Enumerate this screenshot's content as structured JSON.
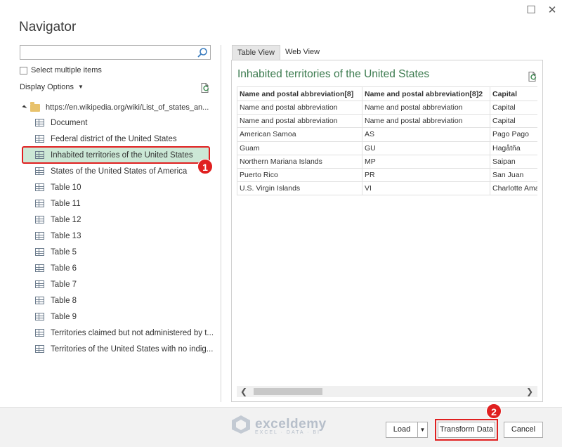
{
  "window": {
    "title": "Navigator",
    "maximize_glyph": "☐",
    "close_glyph": "✕"
  },
  "left": {
    "search_placeholder": "",
    "select_multiple_label": "Select multiple items",
    "display_options_label": "Display Options",
    "root_label": "https://en.wikipedia.org/wiki/List_of_states_an...",
    "items": [
      {
        "label": "Document"
      },
      {
        "label": "Federal district of the United States"
      },
      {
        "label": "Inhabited territories of the United States",
        "selected": true
      },
      {
        "label": "States of the United States of America"
      },
      {
        "label": "Table 10"
      },
      {
        "label": "Table 11"
      },
      {
        "label": "Table 12"
      },
      {
        "label": "Table 13"
      },
      {
        "label": "Table 5"
      },
      {
        "label": "Table 6"
      },
      {
        "label": "Table 7"
      },
      {
        "label": "Table 8"
      },
      {
        "label": "Table 9"
      },
      {
        "label": "Territories claimed but not administered by t..."
      },
      {
        "label": "Territories of the United States with no indig..."
      }
    ]
  },
  "annotations": {
    "badge1": "1",
    "badge2": "2",
    "badge_color": "#e02020"
  },
  "right": {
    "tabs": [
      {
        "label": "Table View",
        "active": true
      },
      {
        "label": "Web View",
        "active": false
      }
    ],
    "preview_title": "Inhabited territories of the United States",
    "columns": [
      "Name and postal abbreviation[8]",
      "Name and postal abbreviation[8]2",
      "Capital"
    ],
    "rows": [
      [
        "Name and postal abbreviation",
        "Name and postal abbreviation",
        "Capital"
      ],
      [
        "Name and postal abbreviation",
        "Name and postal abbreviation",
        "Capital"
      ],
      [
        "American Samoa",
        "AS",
        "Pago Pago"
      ],
      [
        "Guam",
        "GU",
        "Hagåtña"
      ],
      [
        "Northern Mariana Islands",
        "MP",
        "Saipan"
      ],
      [
        "Puerto Rico",
        "PR",
        "San Juan"
      ],
      [
        "U.S. Virgin Islands",
        "VI",
        "Charlotte Ama"
      ]
    ]
  },
  "footer": {
    "logo_name": "exceldemy",
    "logo_tagline": "EXCEL · DATA · BI",
    "load_label": "Load",
    "transform_label": "Transform Data",
    "cancel_label": "Cancel"
  },
  "colors": {
    "selected_bg": "#cce8d6",
    "title_green": "#3b7a4e",
    "highlight_red": "#e02020"
  }
}
